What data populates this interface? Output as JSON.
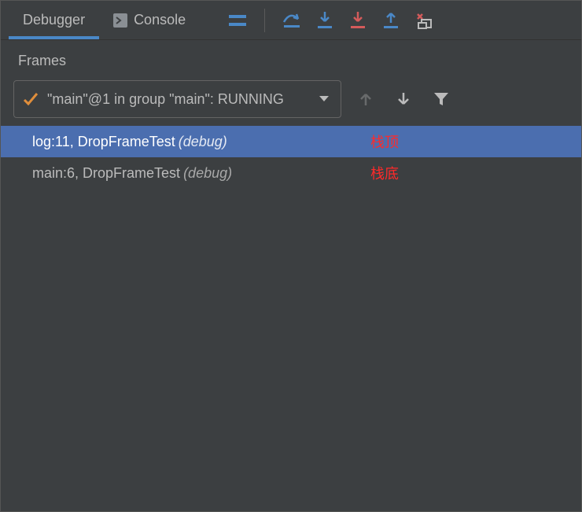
{
  "tabs": {
    "debugger": "Debugger",
    "console": "Console"
  },
  "section": {
    "frames_label": "Frames"
  },
  "thread": {
    "text": "\"main\"@1 in group \"main\": RUNNING"
  },
  "frames": [
    {
      "method": "log:11, DropFrameTest",
      "hint": "(debug)",
      "annotation": "栈顶",
      "selected": true
    },
    {
      "method": "main:6, DropFrameTest",
      "hint": "(debug)",
      "annotation": "栈底",
      "selected": false
    }
  ]
}
